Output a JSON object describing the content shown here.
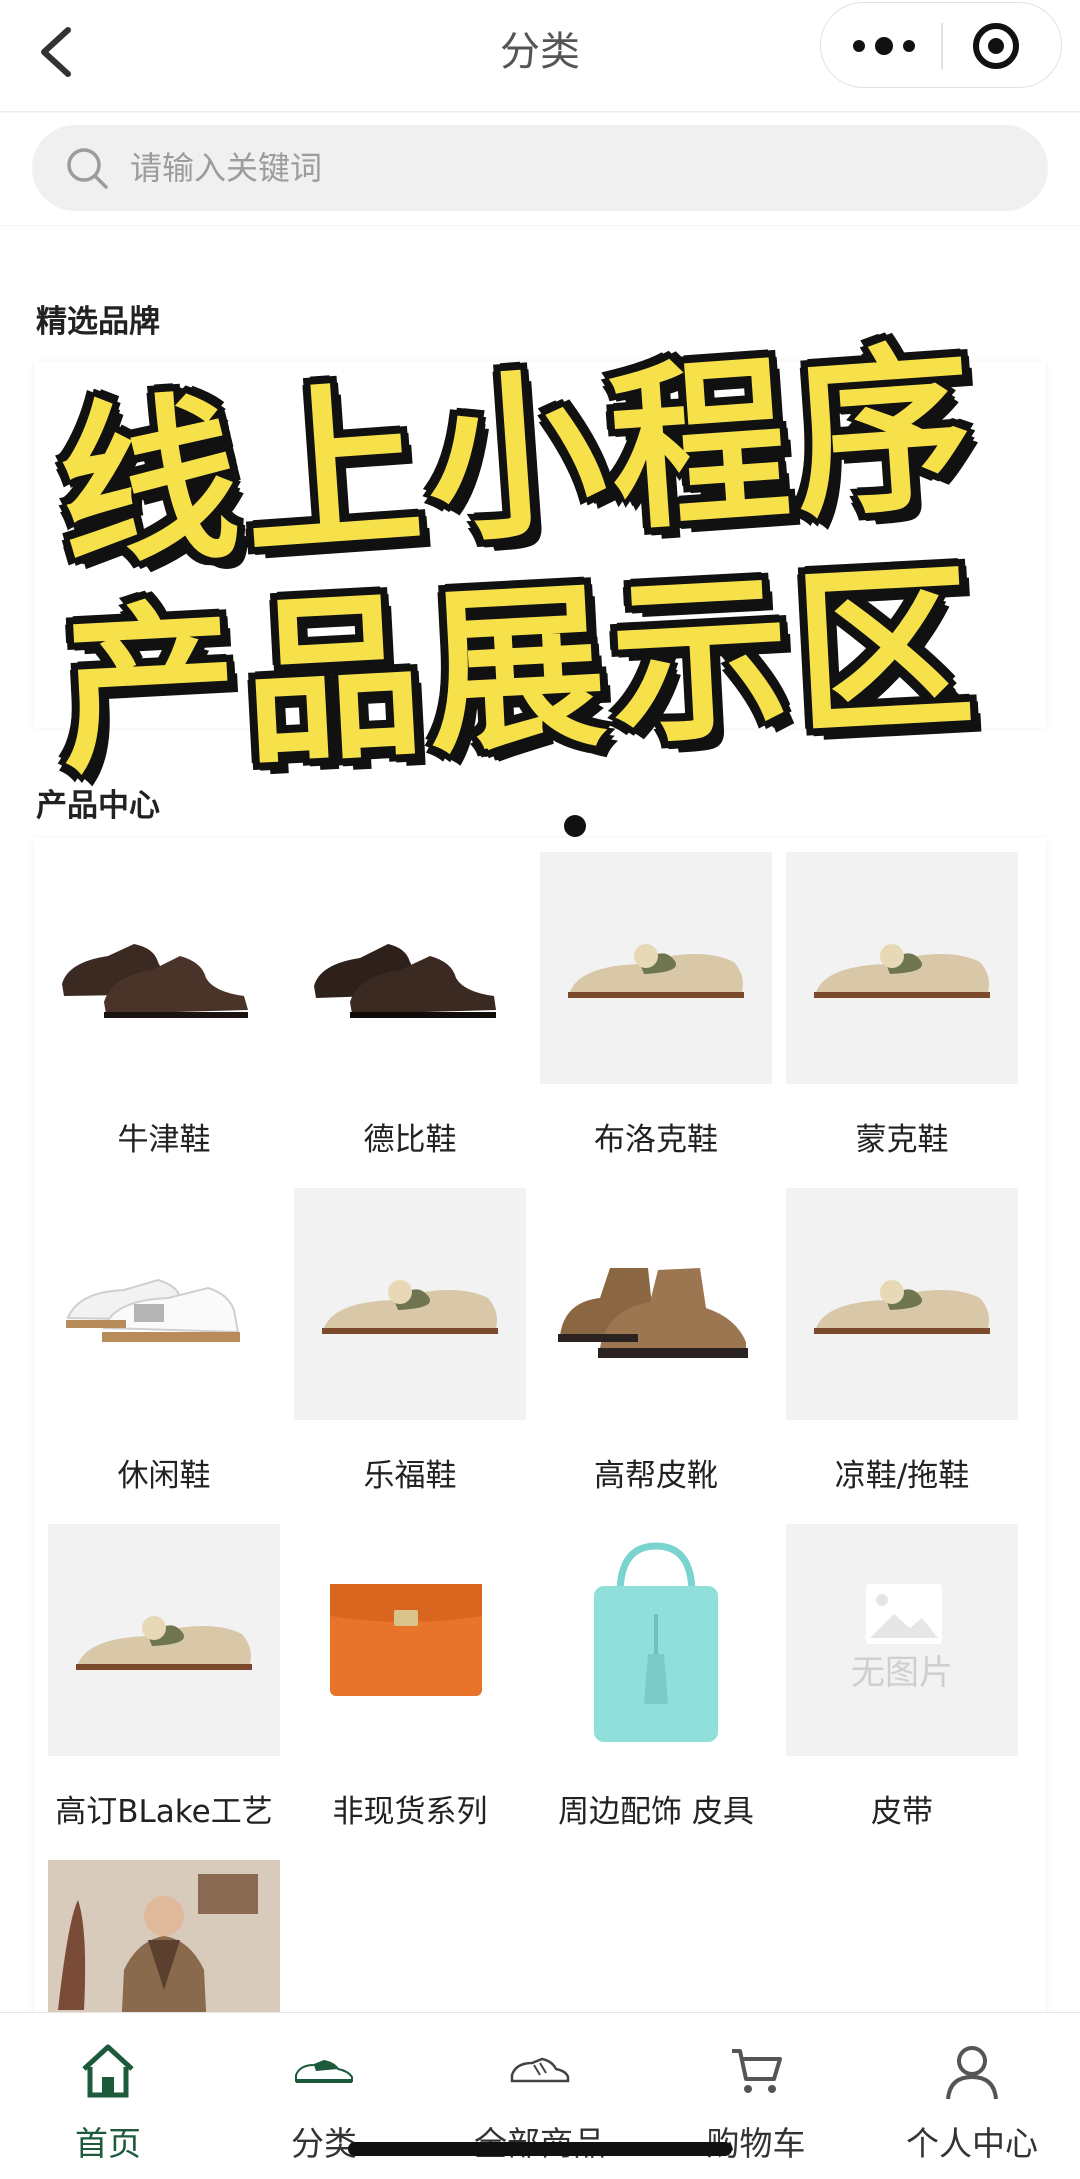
{
  "navbar": {
    "title": "分类",
    "back_icon": "chevron-left-icon",
    "more_icon": "more-dots-icon",
    "close_icon": "target-circle-icon"
  },
  "search": {
    "placeholder": "请输入关键词",
    "icon": "search-icon"
  },
  "sections": {
    "brands_title": "精选品牌",
    "products_title": "产品中心"
  },
  "overlay": {
    "line1": "线上小程序",
    "line2": "产品展示区",
    "color": "#f6e14a"
  },
  "categories": [
    {
      "label": "牛津鞋",
      "image": "oxford-shoes"
    },
    {
      "label": "德比鞋",
      "image": "derby-shoes"
    },
    {
      "label": "布洛克鞋",
      "image": "raffia-loafer"
    },
    {
      "label": "蒙克鞋",
      "image": "raffia-loafer"
    },
    {
      "label": "休闲鞋",
      "image": "white-sneakers"
    },
    {
      "label": "乐福鞋",
      "image": "raffia-loafer"
    },
    {
      "label": "高帮皮靴",
      "image": "suede-chukka-boots"
    },
    {
      "label": "凉鞋/拖鞋",
      "image": "raffia-loafer"
    },
    {
      "label": "高订BLake工艺",
      "image": "raffia-loafer"
    },
    {
      "label": "非现货系列",
      "image": "orange-clutch"
    },
    {
      "label": "周边配饰 皮具",
      "image": "teal-tote-bag"
    },
    {
      "label": "皮带",
      "image": "no-image-placeholder",
      "placeholder_text": "无图片"
    },
    {
      "label": "",
      "image": "tweed-coat-model"
    }
  ],
  "tabbar": {
    "accent": "#1d5a3c",
    "items": [
      {
        "label": "首页",
        "icon": "home-icon",
        "active": true
      },
      {
        "label": "分类",
        "icon": "shoe-icon",
        "active": false
      },
      {
        "label": "全部商品",
        "icon": "shoe-outline-icon",
        "active": false
      },
      {
        "label": "购物车",
        "icon": "cart-icon",
        "active": false
      },
      {
        "label": "个人中心",
        "icon": "person-icon",
        "active": false
      }
    ]
  }
}
